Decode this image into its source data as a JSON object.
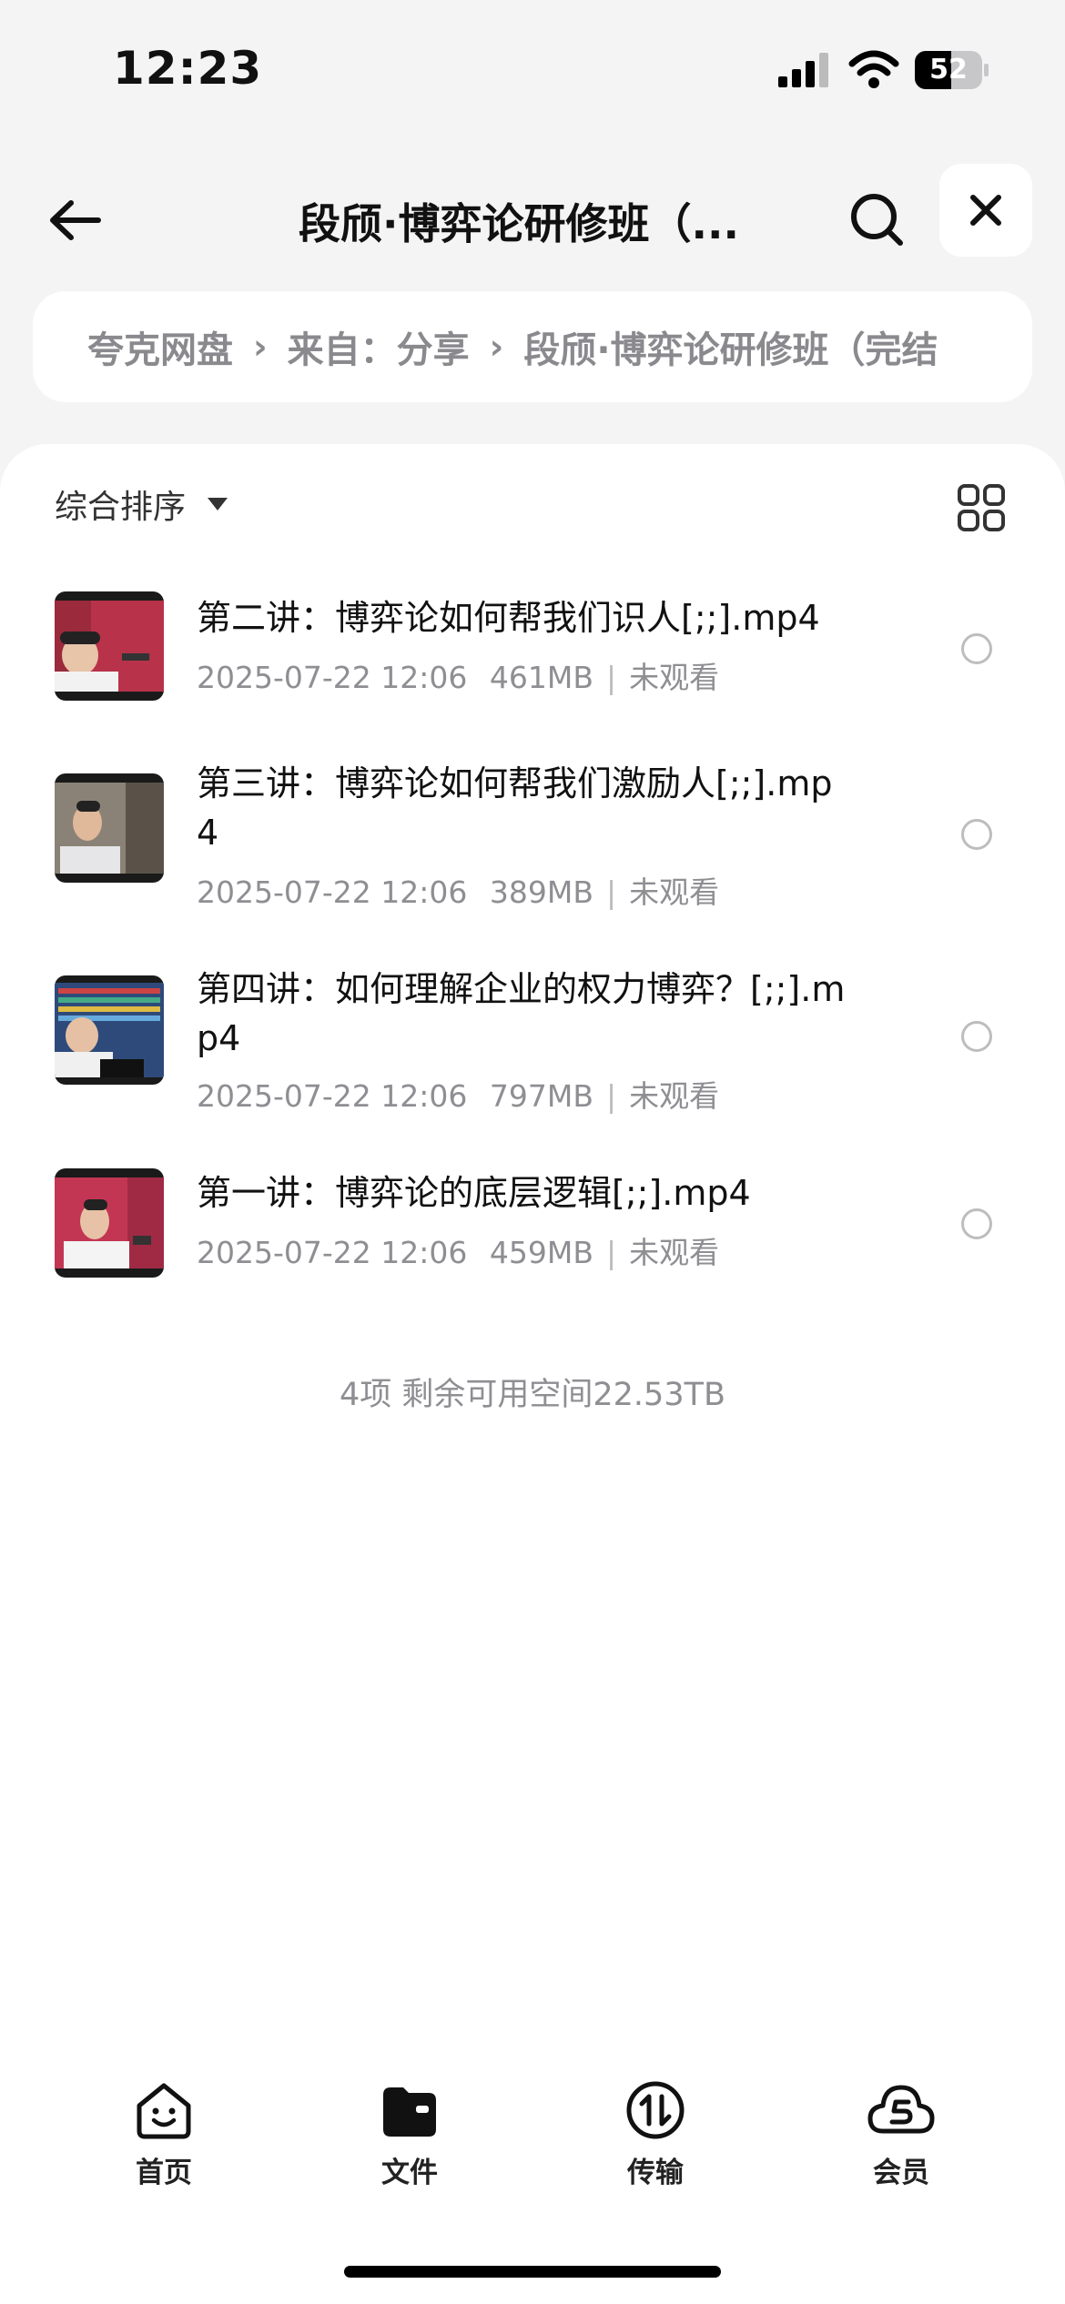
{
  "status": {
    "time": "12:23",
    "battery": "52"
  },
  "header": {
    "title": "段颀·博弈论研修班（..."
  },
  "breadcrumb": [
    "夸克网盘",
    "来自：分享",
    "段颀·博弈论研修班（完结"
  ],
  "sort": {
    "label": "综合排序"
  },
  "files": [
    {
      "name": "第二讲：博弈论如何帮我们识人[;;].mp4",
      "date": "2025-07-22 12:06",
      "size": "461MB",
      "status": "未观看"
    },
    {
      "name": "第三讲：博弈论如何帮我们激励人[;;].mp4",
      "date": "2025-07-22 12:06",
      "size": "389MB",
      "status": "未观看"
    },
    {
      "name": "第四讲：如何理解企业的权力博弈？[;;].mp4",
      "date": "2025-07-22 12:06",
      "size": "797MB",
      "status": "未观看"
    },
    {
      "name": "第一讲：博弈论的底层逻辑[;;].mp4",
      "date": "2025-07-22 12:06",
      "size": "459MB",
      "status": "未观看"
    }
  ],
  "summary": "4项 剩余可用空间22.53TB",
  "tabs": [
    {
      "label": "首页",
      "icon": "home-face-icon"
    },
    {
      "label": "文件",
      "icon": "folder-icon"
    },
    {
      "label": "传输",
      "icon": "transfer-icon"
    },
    {
      "label": "会员",
      "icon": "cloud-member-icon"
    }
  ],
  "colors": {
    "background": "#f4f4f5",
    "panel": "#ffffff",
    "muted": "#8e8e93"
  }
}
